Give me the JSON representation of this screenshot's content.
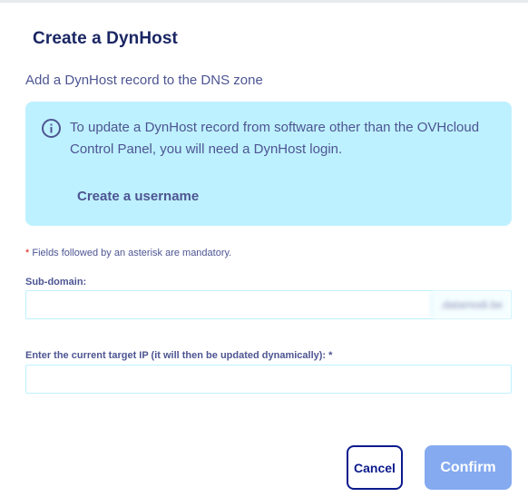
{
  "dialog": {
    "title": "Create a DynHost",
    "subtitle": "Add a DynHost record to the DNS zone"
  },
  "info": {
    "icon": "info-icon",
    "message": "To update a DynHost record from software other than the OVHcloud Control Panel, you will need a DynHost login.",
    "link_label": "Create a username"
  },
  "form": {
    "mandatory_star": "*",
    "mandatory_note": "Fields followed by an asterisk are mandatory.",
    "subdomain_label": "Sub-domain:",
    "subdomain_value": "",
    "subdomain_suffix": ".datamodi.be",
    "ip_label": "Enter the current target IP (it will then be updated dynamically):  *",
    "ip_value": ""
  },
  "actions": {
    "cancel_label": "Cancel",
    "confirm_label": "Confirm"
  },
  "colors": {
    "title": "#1a2663",
    "text": "#4d5592",
    "info_background": "#bef1ff",
    "input_border": "#bef1ff",
    "cancel_border": "#0a1a8c",
    "confirm_background": "#7fa6f0",
    "required_star": "#e61919"
  }
}
